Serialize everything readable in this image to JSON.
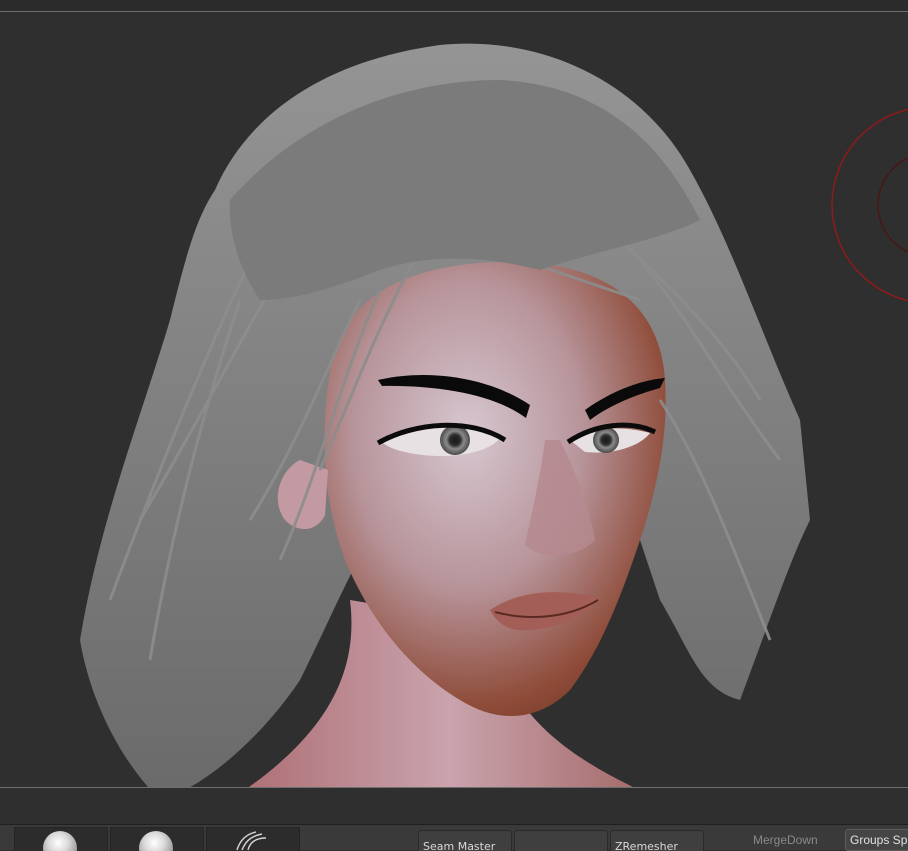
{
  "viewport": {
    "background": "#2f2f2f",
    "hair_color": "#8a8a8a",
    "skin_light": "#cdbac4",
    "skin_dark": "#8a4430",
    "gizmo_color": "#9b1c1c"
  },
  "shelf": {
    "thumbnails": [
      {
        "icon": "sphere-icon"
      },
      {
        "icon": "sphere-icon"
      },
      {
        "icon": "hair-brush-icon"
      }
    ],
    "buttons": [
      {
        "label": "Seam Master"
      },
      {
        "label": ""
      },
      {
        "label": "ZRemesher"
      }
    ],
    "merge_down_label": "MergeDown",
    "groups_split_label": "Groups Split"
  }
}
